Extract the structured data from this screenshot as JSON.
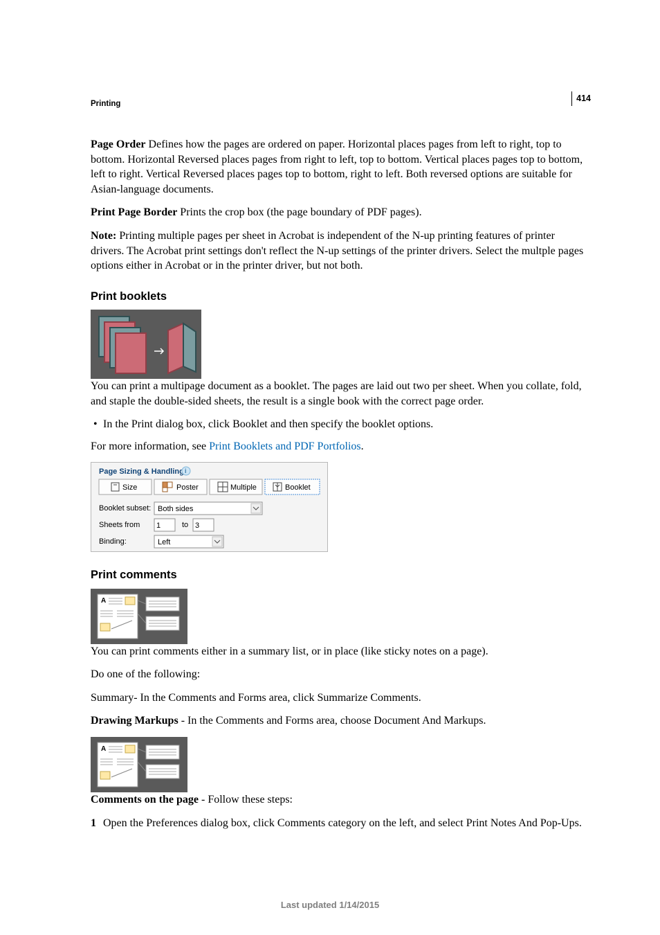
{
  "page_number": "414",
  "running_head": "Printing",
  "footer": "Last updated 1/14/2015",
  "page_order": {
    "label": "Page Order",
    "body": " Defines how the pages are ordered on paper. Horizontal places pages from left to right, top to bottom. Horizontal Reversed places pages from right to left, top to bottom. Vertical places pages top to bottom, left to right. Vertical Reversed places pages top to bottom, right to left. Both reversed options are suitable for Asian-language documents."
  },
  "print_page_border": {
    "label": "Print Page Border",
    "body": " Prints the crop box (the page boundary of PDF pages)."
  },
  "note": {
    "label": "Note:",
    "body": " Printing multiple pages per sheet in Acrobat is independent of the N-up printing features of printer drivers. The Acrobat print settings don't reflect the N-up settings of the printer drivers. Select the multple pages options either in Acrobat or in the printer driver, but not both."
  },
  "booklets": {
    "heading": "Print booklets",
    "para": "You can print a multipage document as a booklet. The pages are laid out two per sheet. When you collate, fold, and staple the double-sided sheets, the result is a single book with the correct page order.",
    "bullet": "In the Print dialog box, click Booklet and then specify the booklet options.",
    "more_info_prefix": "For more information, see ",
    "more_info_link": "Print Booklets and PDF Portfolios",
    "more_info_suffix": "."
  },
  "dialog": {
    "title": "Page Sizing & Handling",
    "tabs": {
      "size": "Size",
      "poster": "Poster",
      "multiple": "Multiple",
      "booklet": "Booklet"
    },
    "labels": {
      "subset": "Booklet subset:",
      "sheets": "Sheets from",
      "to": "to",
      "binding": "Binding:"
    },
    "values": {
      "subset": "Both sides",
      "from": "1",
      "to": "3",
      "binding": "Left"
    }
  },
  "comments": {
    "heading": "Print comments",
    "para1": "You can print comments either in a summary list, or in place (like sticky notes on a page).",
    "para2": "Do one of the following:",
    "summary": "Summary- In the Comments and Forms area, click Summarize Comments.",
    "drawing_label": "Drawing Markups",
    "drawing_body": " - In the Comments and Forms area, choose Document And Markups.",
    "onpage_label": "Comments on the page",
    "onpage_body": " - Follow these steps:",
    "step1": "Open the Preferences dialog box, click Comments category on the left, and select Print Notes And Pop-Ups."
  }
}
